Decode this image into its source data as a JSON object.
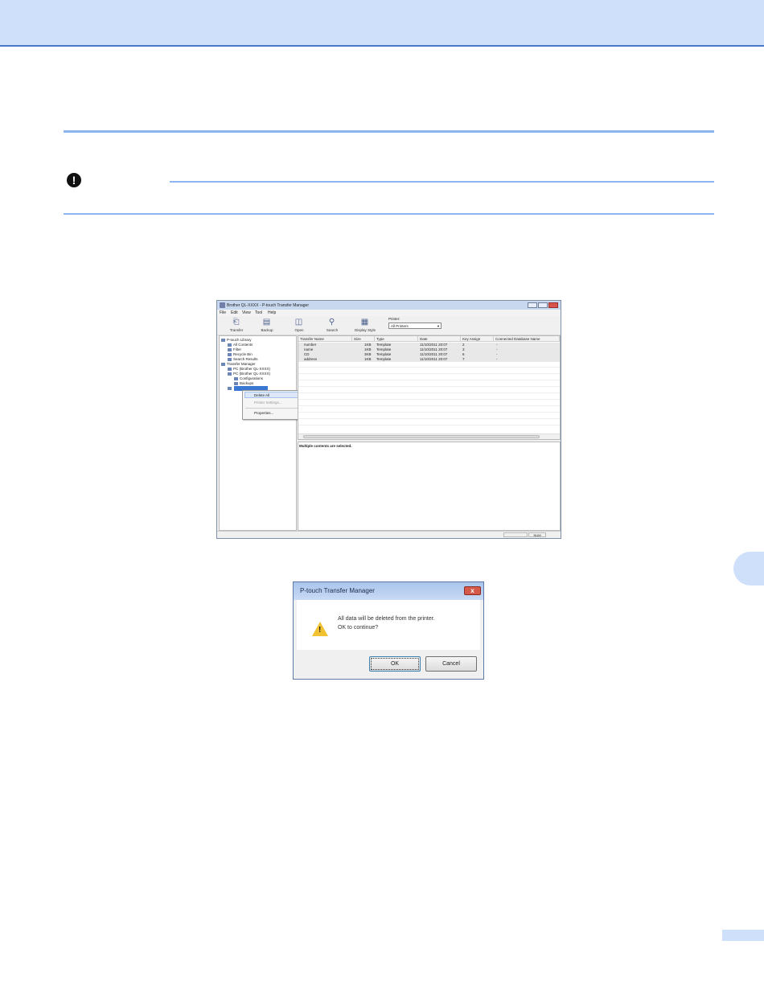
{
  "important_icon": "!",
  "window": {
    "title": "Brother QL-XXXX - P-touch Transfer Manager",
    "menu": [
      "File",
      "Edit",
      "View",
      "Tool",
      "Help"
    ],
    "toolbar": [
      {
        "label": "Transfer",
        "icon": "transfer-icon"
      },
      {
        "label": "Backup",
        "icon": "backup-icon"
      },
      {
        "label": "Open",
        "icon": "open-icon"
      },
      {
        "label": "Search",
        "icon": "search-icon"
      },
      {
        "label": "Display Style",
        "icon": "display-style-icon"
      }
    ],
    "printer_label": "Printer:",
    "printer_value": "All Printers",
    "tree": [
      "P-touch Library",
      "All Contents",
      "Filter",
      "Recycle Bin",
      "Search Results",
      "Transfer Manager",
      "PC (Brother QL-XXXX)",
      "PC (Brother QL-XXXX)",
      "Configurations",
      "Backups"
    ],
    "context_menu": [
      "Delete All",
      "Printer Settings...",
      "Properties..."
    ],
    "columns": [
      "Transfer Name",
      "Size",
      "Type",
      "Date",
      "Key Assign",
      "Connected Database Name"
    ],
    "rows": [
      [
        "number",
        "1KB",
        "Template",
        "11/10/2011 20:07",
        "2",
        "-"
      ],
      [
        "name",
        "1KB",
        "Template",
        "11/10/2011 20:07",
        "3",
        "-"
      ],
      [
        "CD",
        "3KB",
        "Template",
        "11/10/2011 20:07",
        "6",
        "-"
      ],
      [
        "address",
        "1KB",
        "Template",
        "11/10/2011 20:07",
        "7",
        "-"
      ]
    ],
    "detail_text": "Multiple contents are selected.",
    "status_panel": "NUM"
  },
  "dialog": {
    "title": "P-touch Transfer Manager",
    "message_line1": "All data will be deleted from the printer.",
    "message_line2": "OK to continue?",
    "ok_label": "OK",
    "cancel_label": "Cancel",
    "close_glyph": "x"
  }
}
